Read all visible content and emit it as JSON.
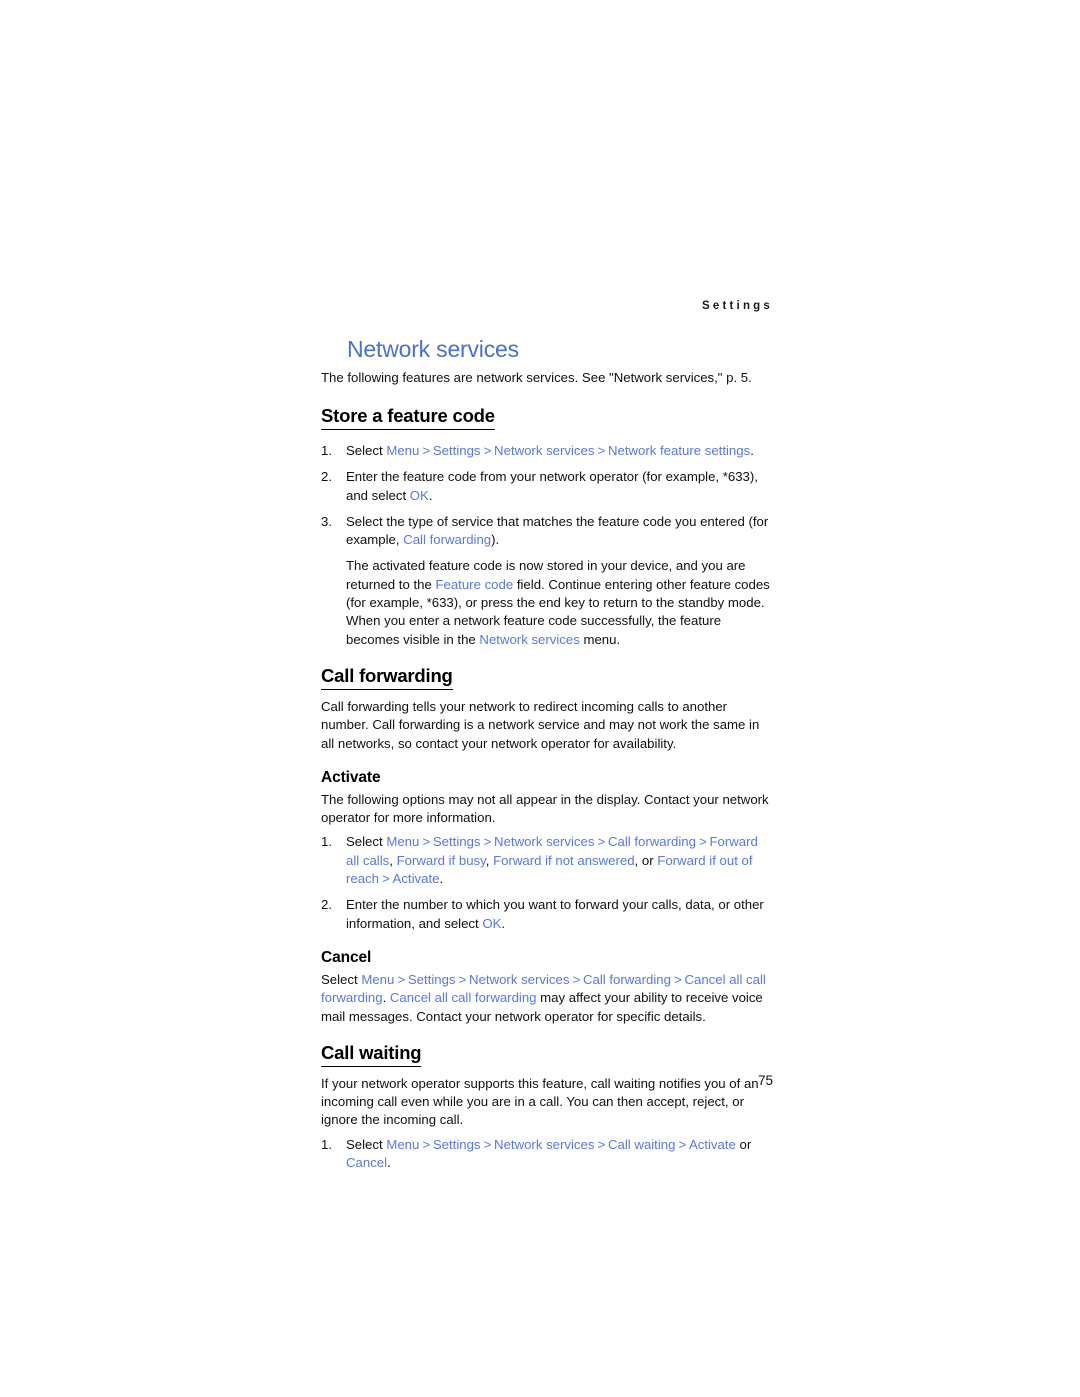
{
  "page": {
    "running_head": "Settings",
    "page_number": "75"
  },
  "title": "Network services",
  "intro": "The following features are network services. See \"Network services,\" p. 5.",
  "sections": [
    {
      "heading": "Store a feature code",
      "steps": [
        {
          "parts": [
            {
              "t": "Select ",
              "style": "plain"
            },
            {
              "t": "Menu",
              "style": "ui"
            },
            {
              "t": " > ",
              "style": "arrow"
            },
            {
              "t": "Settings",
              "style": "ui"
            },
            {
              "t": " > ",
              "style": "arrow"
            },
            {
              "t": "Network services",
              "style": "ui"
            },
            {
              "t": " > ",
              "style": "arrow"
            },
            {
              "t": "Network feature settings",
              "style": "ui"
            },
            {
              "t": ".",
              "style": "plain"
            }
          ]
        },
        {
          "parts": [
            {
              "t": "Enter the feature code from your network operator (for example, *633), and select ",
              "style": "plain"
            },
            {
              "t": "OK",
              "style": "ui"
            },
            {
              "t": ".",
              "style": "plain"
            }
          ]
        },
        {
          "parts": [
            {
              "t": "Select the type of service that matches the feature code you entered (for example, ",
              "style": "plain"
            },
            {
              "t": "Call forwarding",
              "style": "ui"
            },
            {
              "t": ").",
              "style": "plain"
            }
          ]
        }
      ],
      "continuation": {
        "parts": [
          {
            "t": "The activated feature code is now stored in your device, and you are returned to the ",
            "style": "plain"
          },
          {
            "t": "Feature code",
            "style": "ui"
          },
          {
            "t": " field. Continue entering other feature codes (for example, *633), or press the end key to return to the standby mode. When you enter a network feature code successfully, the feature becomes visible in the ",
            "style": "plain"
          },
          {
            "t": "Network services",
            "style": "ui"
          },
          {
            "t": " menu.",
            "style": "plain"
          }
        ]
      }
    },
    {
      "heading": "Call forwarding",
      "body": "Call forwarding tells your network to redirect incoming calls to another number. Call forwarding is a network service and may not work the same in all networks, so contact your network operator for availability.",
      "subsections": [
        {
          "heading": "Activate",
          "body": "The following options may not all appear in the display. Contact your network operator for more information.",
          "steps": [
            {
              "parts": [
                {
                  "t": "Select ",
                  "style": "plain"
                },
                {
                  "t": "Menu",
                  "style": "ui"
                },
                {
                  "t": " > ",
                  "style": "arrow"
                },
                {
                  "t": "Settings",
                  "style": "ui"
                },
                {
                  "t": " > ",
                  "style": "arrow"
                },
                {
                  "t": "Network services",
                  "style": "ui"
                },
                {
                  "t": " > ",
                  "style": "arrow"
                },
                {
                  "t": "Call forwarding",
                  "style": "ui"
                },
                {
                  "t": " > ",
                  "style": "arrow"
                },
                {
                  "t": "Forward all calls",
                  "style": "ui"
                },
                {
                  "t": ", ",
                  "style": "plain"
                },
                {
                  "t": "Forward if busy",
                  "style": "ui"
                },
                {
                  "t": ", ",
                  "style": "plain"
                },
                {
                  "t": "Forward if not answered",
                  "style": "ui"
                },
                {
                  "t": ", or ",
                  "style": "plain"
                },
                {
                  "t": "Forward if out of reach",
                  "style": "ui"
                },
                {
                  "t": " > ",
                  "style": "arrow"
                },
                {
                  "t": "Activate",
                  "style": "ui"
                },
                {
                  "t": ".",
                  "style": "plain"
                }
              ]
            },
            {
              "parts": [
                {
                  "t": "Enter the number to which you want to forward your calls, data, or other information, and select ",
                  "style": "plain"
                },
                {
                  "t": "OK",
                  "style": "ui"
                },
                {
                  "t": ".",
                  "style": "plain"
                }
              ]
            }
          ]
        },
        {
          "heading": "Cancel",
          "paragraph": {
            "parts": [
              {
                "t": "Select ",
                "style": "plain"
              },
              {
                "t": "Menu",
                "style": "ui"
              },
              {
                "t": " > ",
                "style": "arrow"
              },
              {
                "t": "Settings",
                "style": "ui"
              },
              {
                "t": " > ",
                "style": "arrow"
              },
              {
                "t": "Network services",
                "style": "ui"
              },
              {
                "t": " > ",
                "style": "arrow"
              },
              {
                "t": "Call forwarding",
                "style": "ui"
              },
              {
                "t": " > ",
                "style": "arrow"
              },
              {
                "t": "Cancel all call forwarding",
                "style": "ui"
              },
              {
                "t": ". ",
                "style": "plain"
              },
              {
                "t": "Cancel all call forwarding",
                "style": "ui"
              },
              {
                "t": " may affect your ability to receive voice mail messages. Contact your network operator for specific details.",
                "style": "plain"
              }
            ]
          }
        }
      ]
    },
    {
      "heading": "Call waiting",
      "body": "If your network operator supports this feature, call waiting notifies you of an incoming call even while you are in a call. You can then accept, reject, or ignore the incoming call.",
      "steps": [
        {
          "parts": [
            {
              "t": "Select ",
              "style": "plain"
            },
            {
              "t": "Menu",
              "style": "ui"
            },
            {
              "t": " > ",
              "style": "arrow"
            },
            {
              "t": "Settings",
              "style": "ui"
            },
            {
              "t": " > ",
              "style": "arrow"
            },
            {
              "t": "Network services",
              "style": "ui"
            },
            {
              "t": " > ",
              "style": "arrow"
            },
            {
              "t": "Call waiting",
              "style": "ui"
            },
            {
              "t": " > ",
              "style": "arrow"
            },
            {
              "t": "Activate",
              "style": "ui"
            },
            {
              "t": " or ",
              "style": "plain"
            },
            {
              "t": "Cancel",
              "style": "ui"
            },
            {
              "t": ".",
              "style": "plain"
            }
          ]
        }
      ]
    }
  ]
}
